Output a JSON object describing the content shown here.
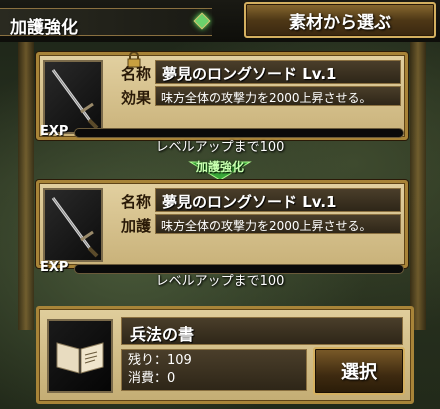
{
  "header": {
    "title": "加護強化",
    "select_material_label": "素材から選ぶ"
  },
  "current_item": {
    "name_label": "名称",
    "name": "夢見のロングソード Lv.1",
    "effect_label": "効果",
    "effect": "味方全体の攻撃力を2000上昇させる。",
    "exp_label": "EXP",
    "exp_progress": 0,
    "exp_caption": "レベルアップまで100"
  },
  "enhance_label": "加護強化",
  "result_item": {
    "name_label": "名称",
    "name": "夢見のロングソード Lv.1",
    "effect_label": "加護",
    "effect": "味方全体の攻撃力を2000上昇させる。",
    "exp_label": "EXP",
    "exp_progress": 0,
    "exp_caption": "レベルアップまで100"
  },
  "material": {
    "name": "兵法の書",
    "remaining": "残り：109",
    "consumed": "消費：0",
    "select_label": "選択"
  },
  "colors": {
    "accent_gold": "#b8913a",
    "exp_fill": "#8ac84a",
    "enhance_green": "#6bd16b"
  },
  "icons": {
    "weapon": "sword-icon",
    "lock": "lock-icon",
    "material": "book-icon",
    "enhance": "arrow-down-icon"
  }
}
